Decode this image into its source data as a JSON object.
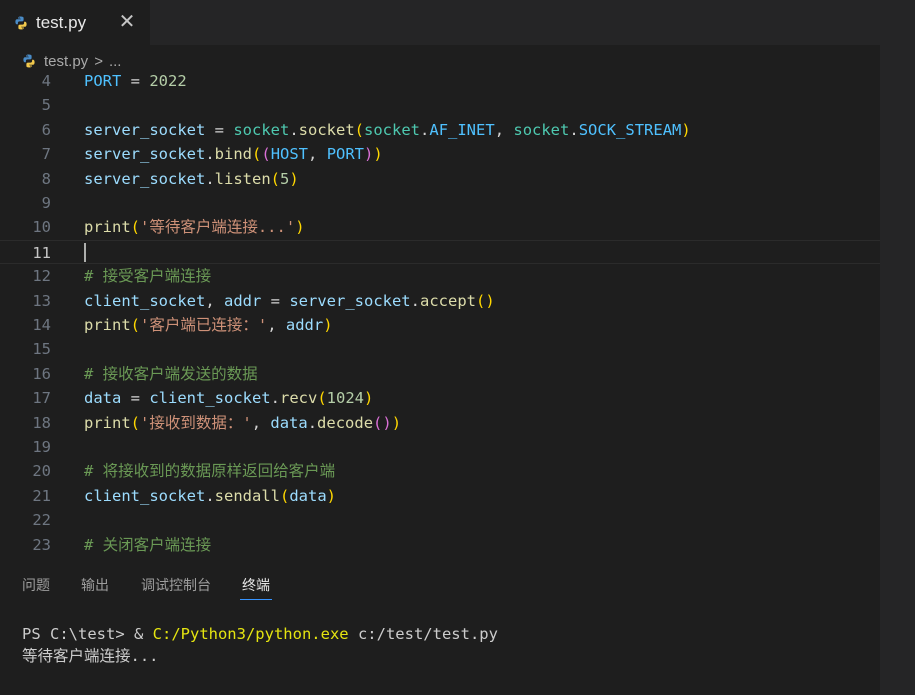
{
  "tab": {
    "label": "test.py",
    "close": "✕",
    "icon": "python-icon"
  },
  "breadcrumb": {
    "file": "test.py",
    "separator": ">",
    "more": "..."
  },
  "editor": {
    "current_line": "11",
    "lines": [
      {
        "num": "4",
        "tokens": [
          "PORT",
          " = ",
          "2022"
        ]
      },
      {
        "num": "5"
      },
      {
        "num": "6",
        "tokens": [
          "server_socket",
          " = ",
          "socket",
          ".",
          "socket",
          "(",
          "socket",
          ".",
          "AF_INET",
          ", ",
          "socket",
          ".",
          "SOCK_STREAM",
          ")"
        ]
      },
      {
        "num": "7",
        "tokens": [
          "server_socket",
          ".",
          "bind",
          "(",
          "(",
          "HOST",
          ", ",
          "PORT",
          ")",
          ")"
        ]
      },
      {
        "num": "8",
        "tokens": [
          "server_socket",
          ".",
          "listen",
          "(",
          "5",
          ")"
        ]
      },
      {
        "num": "9"
      },
      {
        "num": "10",
        "tokens": [
          "print",
          "(",
          "'等待客户端连接...'",
          ")"
        ]
      },
      {
        "num": "11"
      },
      {
        "num": "12",
        "tokens": [
          "# 接受客户端连接"
        ]
      },
      {
        "num": "13",
        "tokens": [
          "client_socket",
          ", ",
          "addr",
          " = ",
          "server_socket",
          ".",
          "accept",
          "(",
          ")"
        ]
      },
      {
        "num": "14",
        "tokens": [
          "print",
          "(",
          "'客户端已连接：'",
          ", ",
          "addr",
          ")"
        ]
      },
      {
        "num": "15"
      },
      {
        "num": "16",
        "tokens": [
          "# 接收客户端发送的数据"
        ]
      },
      {
        "num": "17",
        "tokens": [
          "data",
          " = ",
          "client_socket",
          ".",
          "recv",
          "(",
          "1024",
          ")"
        ]
      },
      {
        "num": "18",
        "tokens": [
          "print",
          "(",
          "'接收到数据：'",
          ", ",
          "data",
          ".",
          "decode",
          "(",
          ")",
          ")"
        ]
      },
      {
        "num": "19"
      },
      {
        "num": "20",
        "tokens": [
          "# 将接收到的数据原样返回给客户端"
        ]
      },
      {
        "num": "21",
        "tokens": [
          "client_socket",
          ".",
          "sendall",
          "(",
          "data",
          ")"
        ]
      },
      {
        "num": "22"
      },
      {
        "num": "23",
        "tokens": [
          "# 关闭客户端连接"
        ]
      }
    ]
  },
  "panel": {
    "tabs": [
      "问题",
      "输出",
      "调试控制台",
      "终端"
    ],
    "active_tab": "终端"
  },
  "terminal": {
    "prompt": "PS C:\\test> ",
    "operator": "& ",
    "exe": "C:/Python3/python.exe",
    "arg": " c:/test/test.py",
    "output": "等待客户端连接..."
  },
  "colors": {
    "background": "#1e1e1e",
    "tabbar": "#252526",
    "active_tab_underline": "#3794ff"
  }
}
